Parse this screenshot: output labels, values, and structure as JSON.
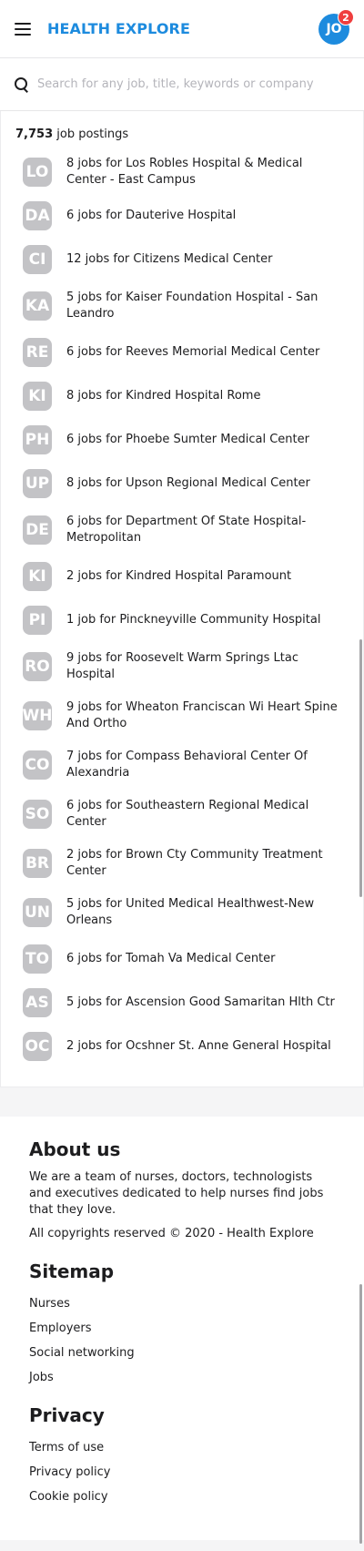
{
  "header": {
    "brand": "HEALTH EXPLORE",
    "avatar_initials": "JO",
    "notification_count": "2"
  },
  "search": {
    "placeholder": "Search for any job, title, keywords or company"
  },
  "results": {
    "count": "7,753",
    "count_suffix": " job postings",
    "items": [
      {
        "initials": "LO",
        "text": "8 jobs for Los Robles Hospital & Medical Center - East Campus"
      },
      {
        "initials": "DA",
        "text": "6 jobs for Dauterive Hospital"
      },
      {
        "initials": "CI",
        "text": "12 jobs for Citizens Medical Center"
      },
      {
        "initials": "KA",
        "text": "5 jobs for Kaiser Foundation Hospital - San Leandro"
      },
      {
        "initials": "RE",
        "text": "6 jobs for Reeves Memorial Medical Center"
      },
      {
        "initials": "KI",
        "text": "8 jobs for Kindred Hospital Rome"
      },
      {
        "initials": "PH",
        "text": "6 jobs for Phoebe Sumter Medical Center"
      },
      {
        "initials": "UP",
        "text": "8 jobs for Upson Regional Medical Center"
      },
      {
        "initials": "DE",
        "text": "6 jobs for Department Of State Hospital-Metropolitan"
      },
      {
        "initials": "KI",
        "text": "2 jobs for Kindred Hospital Paramount"
      },
      {
        "initials": "PI",
        "text": "1 job for Pinckneyville Community Hospital"
      },
      {
        "initials": "RO",
        "text": "9 jobs for Roosevelt Warm Springs Ltac Hospital"
      },
      {
        "initials": "WH",
        "text": "9 jobs for Wheaton Franciscan Wi Heart Spine And Ortho"
      },
      {
        "initials": "CO",
        "text": "7 jobs for Compass Behavioral Center Of Alexandria"
      },
      {
        "initials": "SO",
        "text": "6 jobs for Southeastern Regional Medical Center"
      },
      {
        "initials": "BR",
        "text": "2 jobs for Brown Cty Community Treatment Center"
      },
      {
        "initials": "UN",
        "text": "5 jobs for United Medical Healthwest-New Orleans"
      },
      {
        "initials": "TO",
        "text": "6 jobs for Tomah Va Medical Center"
      },
      {
        "initials": "AS",
        "text": "5 jobs for Ascension Good Samaritan Hlth Ctr"
      },
      {
        "initials": "OC",
        "text": "2 jobs for Ocshner St. Anne General Hospital"
      }
    ]
  },
  "footer": {
    "about_title": "About us",
    "about_text": "We are a team of nurses, doctors, technologists and executives dedicated to help nurses find jobs that they love.",
    "copyright": "All copyrights reserved © 2020 - Health Explore",
    "sitemap_title": "Sitemap",
    "sitemap_links": [
      "Nurses",
      "Employers",
      "Social networking",
      "Jobs"
    ],
    "privacy_title": "Privacy",
    "privacy_links": [
      "Terms of use",
      "Privacy policy",
      "Cookie policy"
    ]
  },
  "colors": {
    "brand": "#1d8bde",
    "badge": "#ef3e3e",
    "logo_bg": "#c3c3c6"
  },
  "icons": [
    "hamburger-menu-icon",
    "search-icon"
  ]
}
